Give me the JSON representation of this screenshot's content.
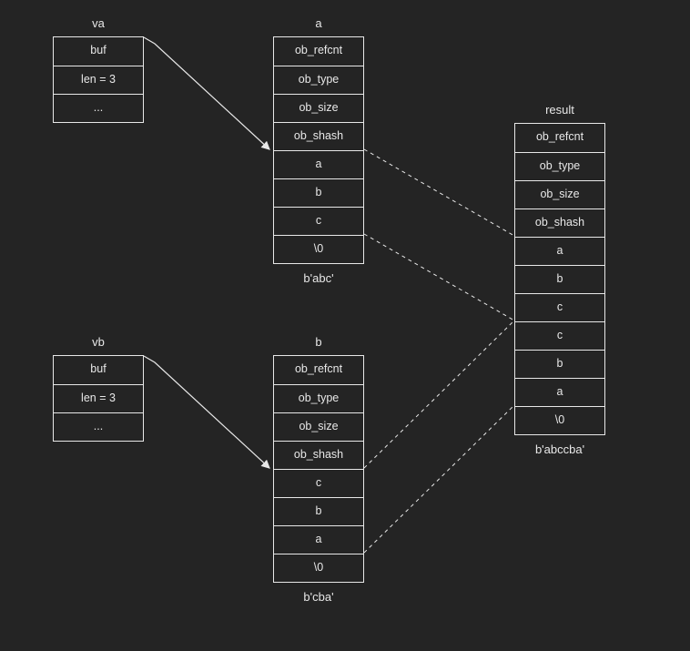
{
  "va": {
    "label": "va",
    "cells": [
      "buf",
      "len = 3",
      "..."
    ]
  },
  "vb": {
    "label": "vb",
    "cells": [
      "buf",
      "len = 3",
      "..."
    ]
  },
  "a": {
    "label": "a",
    "cells": [
      "ob_refcnt",
      "ob_type",
      "ob_size",
      "ob_shash",
      "a",
      "b",
      "c",
      "\\0"
    ],
    "caption": "b'abc'"
  },
  "b": {
    "label": "b",
    "cells": [
      "ob_refcnt",
      "ob_type",
      "ob_size",
      "ob_shash",
      "c",
      "b",
      "a",
      "\\0"
    ],
    "caption": "b'cba'"
  },
  "result": {
    "label": "result",
    "cells": [
      "ob_refcnt",
      "ob_type",
      "ob_size",
      "ob_shash",
      "a",
      "b",
      "c",
      "c",
      "b",
      "a",
      "\\0"
    ],
    "caption": "b'abccba'"
  }
}
